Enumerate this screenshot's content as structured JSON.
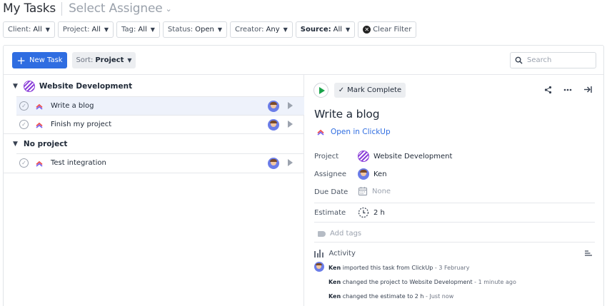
{
  "header": {
    "title": "My Tasks",
    "assignee_placeholder": "Select Assignee",
    "assignee_chevron": "⌄"
  },
  "filters": [
    {
      "key": "Client:",
      "value": "All"
    },
    {
      "key": "Project:",
      "value": "All"
    },
    {
      "key": "Tag:",
      "value": "All"
    },
    {
      "key": "Status:",
      "value": "Open"
    },
    {
      "key": "Creator:",
      "value": "Any"
    },
    {
      "key": "Source:",
      "value": "All"
    }
  ],
  "clear_filter": "Clear Filter",
  "toolbar": {
    "new_task": "New Task",
    "sort_key": "Sort:",
    "sort_value": "Project",
    "search_placeholder": "Search"
  },
  "groups": [
    {
      "name": "Website Development",
      "tasks": [
        "Write a blog",
        "Finish my project"
      ]
    },
    {
      "name": "No project",
      "tasks": [
        "Test integration"
      ]
    }
  ],
  "detail": {
    "mark_complete": "Mark Complete",
    "title": "Write a blog",
    "open_link": "Open in ClickUp",
    "fields": {
      "project_label": "Project",
      "project_value": "Website Development",
      "assignee_label": "Assignee",
      "assignee_value": "Ken",
      "due_label": "Due Date",
      "due_value": "None",
      "estimate_label": "Estimate",
      "estimate_value": "2 h"
    },
    "add_tags": "Add tags",
    "activity_label": "Activity",
    "activity": [
      {
        "user": "Ken",
        "text": "imported this task from ClickUp",
        "time": " - 3 February"
      },
      {
        "user": "Ken",
        "text": "changed the project to Website Development",
        "time": " - 1 minute ago"
      },
      {
        "user": "Ken",
        "text": "changed the estimate to 2 h",
        "time": " - Just now"
      }
    ]
  },
  "colors": {
    "accent": "#2f6de1",
    "play_green": "#1aa34a",
    "project_purple": "#8b3fd9",
    "selected_row": "#eef2fb"
  },
  "icons": [
    "chevron-down-icon",
    "plus-icon",
    "search-icon",
    "play-icon",
    "check-icon",
    "share-icon",
    "more-icon",
    "collapse-panel-icon",
    "clickup-logo-icon",
    "calendar-icon",
    "clock-icon",
    "tag-icon",
    "activity-chart-icon",
    "sort-lines-icon",
    "clear-x-icon"
  ]
}
